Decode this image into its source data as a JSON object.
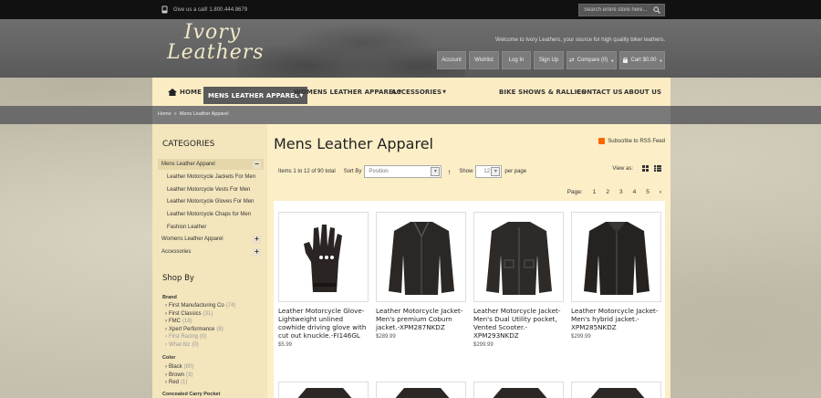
{
  "topbar": {
    "phone_text": "Give us a call! 1.800.444.8679",
    "search_placeholder": "Search entire store here..."
  },
  "header": {
    "logo_line1": "Ivory",
    "logo_line2": "Leathers",
    "welcome": "Welcome to Ivory Leathers, your source for high quality biker leathers.",
    "links": {
      "account": "Account",
      "wishlist": "Wishlist",
      "login": "Log In",
      "signup": "Sign Up",
      "compare": "Compare (0)",
      "cart": "Cart $0.00"
    }
  },
  "nav": {
    "home": "HOME",
    "mens": "MENS LEATHER APPAREL",
    "womens": "WOMENS LEATHER APPAREL",
    "accessories": "ACCESSORIES",
    "bike_shows": "BIKE SHOWS & RALLIES",
    "contact": "CONTACT US",
    "about": "ABOUT US"
  },
  "breadcrumb": {
    "home": "Home",
    "sep": "»",
    "current": "Mens Leather Apparel"
  },
  "sidebar": {
    "categories_title": "CATEGORIES",
    "categories": [
      {
        "label": "Mens Leather Apparel",
        "toggle": "−"
      },
      {
        "label": "Leather Motorcycle Jackets For Men"
      },
      {
        "label": "Leather Motorcycle Vests For Men"
      },
      {
        "label": "Leather Motorcycle Gloves For Men"
      },
      {
        "label": "Leather Motorcycle Chaps for Men"
      },
      {
        "label": "Fashion Leather"
      },
      {
        "label": "Womens Leather Apparel",
        "toggle": "+"
      },
      {
        "label": "Accessories",
        "toggle": "+"
      }
    ],
    "shop_by_title": "Shop By",
    "brand_title": "Brand",
    "brands": [
      {
        "label": "First Manufacturing Co",
        "count": "(74)"
      },
      {
        "label": "First Classics",
        "count": "(31)"
      },
      {
        "label": "FMC",
        "count": "(18)"
      },
      {
        "label": "Xpert Performance",
        "count": "(8)"
      },
      {
        "label": "First Racing",
        "count": "(0)"
      },
      {
        "label": "What biz",
        "count": "(0)"
      }
    ],
    "color_title": "Color",
    "colors": [
      {
        "label": "Black",
        "count": "(80)"
      },
      {
        "label": "Brown",
        "count": "(3)"
      },
      {
        "label": "Red",
        "count": "(1)"
      }
    ],
    "concealed_title": "Concealed Carry Pocket"
  },
  "main": {
    "title": "Mens Leather Apparel",
    "rss": "Subscribe to RSS Feed",
    "items_count": "Items 1 to 12 of 90 total",
    "sort_by_label": "Sort By",
    "sort_value": "Position",
    "show_label": "Show",
    "show_value": "12",
    "per_page": "per page",
    "view_as": "View as:",
    "page_label": "Page:",
    "pages": [
      "1",
      "2",
      "3",
      "4",
      "5"
    ],
    "next": "›"
  },
  "products": [
    {
      "name": "Leather Motorcycle Glove-Lightweight unlined cowhide driving glove with cut out knuckle.-FI146GL",
      "price": "$5.99"
    },
    {
      "name": "Leather Motorcycle Jacket-Men's premium Coburn jacket.-XPM287NKDZ",
      "price": "$289.99"
    },
    {
      "name": "Leather Motorcycle Jacket-Men's Dual Utility pocket, Vented Scooter.-XPM293NKDZ",
      "price": "$299.99"
    },
    {
      "name": "Leather Motorcycle Jacket-Men's hybrid jacket.-XPM285NKDZ",
      "price": "$299.99"
    }
  ]
}
